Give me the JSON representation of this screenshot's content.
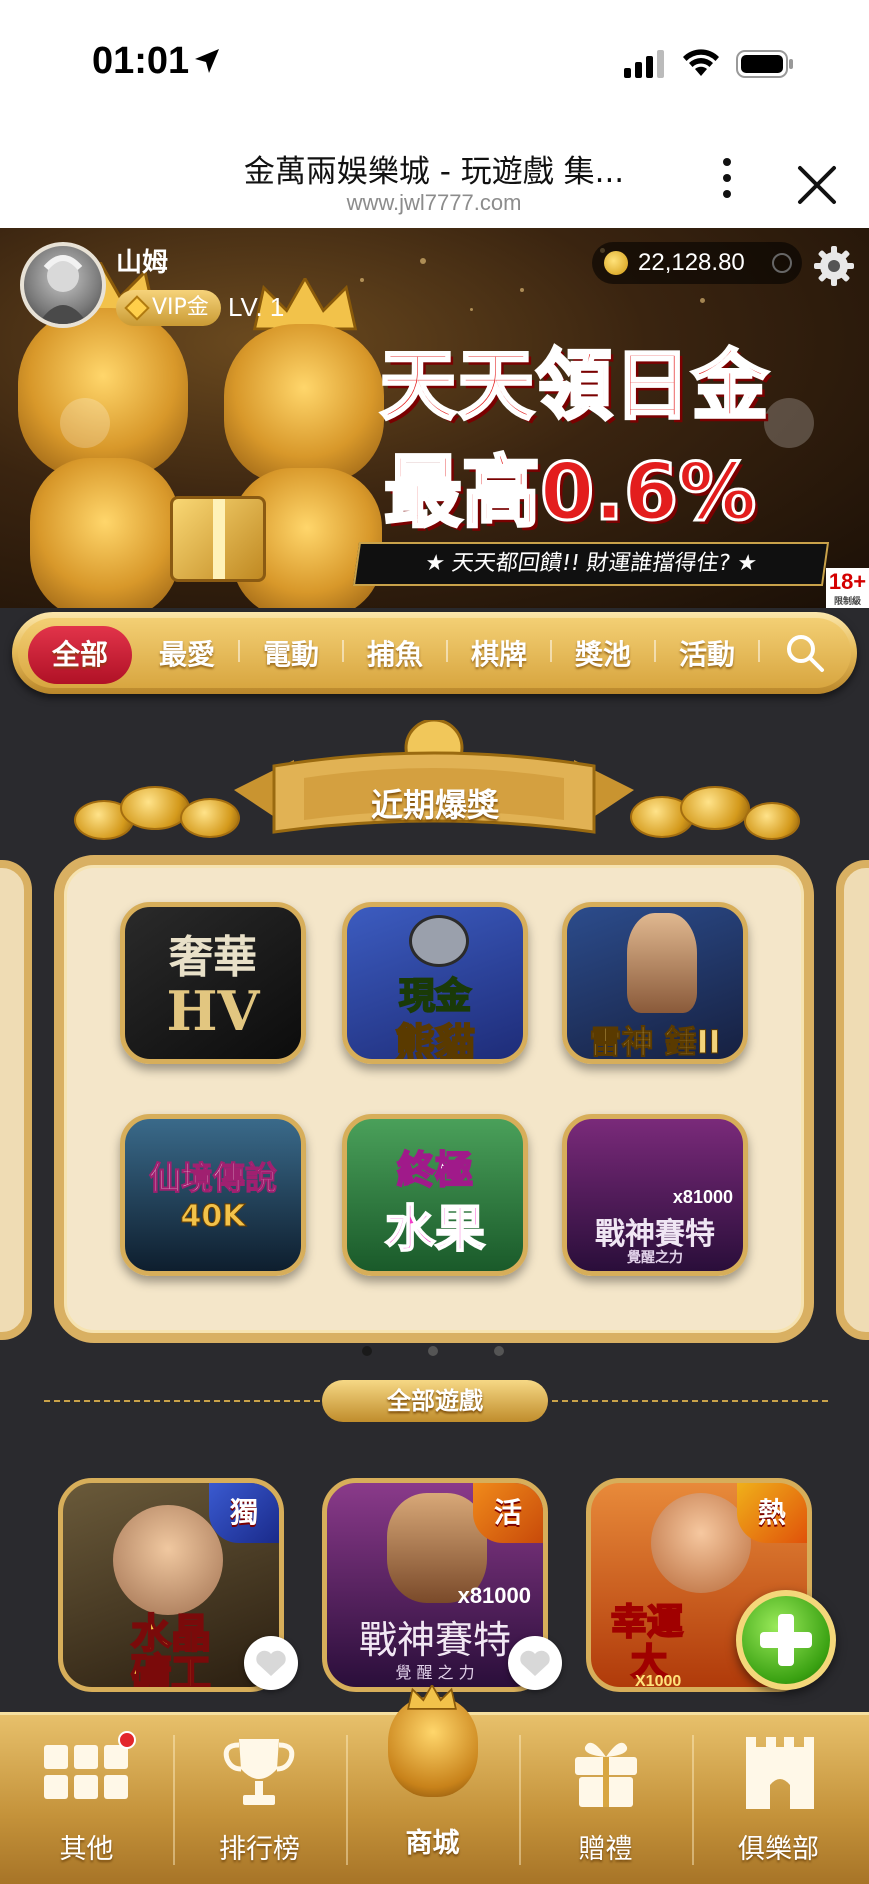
{
  "status_bar": {
    "time": "01:01"
  },
  "browser": {
    "title": "金萬兩娛樂城 - 玩遊戲 集...",
    "url": "www.jwl7777.com"
  },
  "user": {
    "name": "山姆",
    "vip": "VIP金",
    "level": "LV. 1",
    "balance": "22,128.80"
  },
  "banner": {
    "headline": "天天領日金",
    "headline2": "最高0.6%",
    "subtitle": "★ 天天都回饋!! 財運誰擋得住? ★",
    "age_badge": "18+",
    "age_badge_sub": "限制級"
  },
  "tabs": [
    "全部",
    "最愛",
    "電動",
    "捕魚",
    "棋牌",
    "獎池",
    "活動"
  ],
  "recent": {
    "title": "近期爆獎",
    "games": [
      {
        "line1": "奢華",
        "line2": "HV"
      },
      {
        "line1": "現金",
        "line2": "熊貓"
      },
      {
        "line1": "雷神",
        "line2": "錘II"
      },
      {
        "line1": "仙境傳說",
        "line2": "40K"
      },
      {
        "line1": "終極",
        "line2": "水果"
      },
      {
        "line1": "戰神賽特",
        "line2": "覺醒之力",
        "badge": "x81000"
      }
    ]
  },
  "all_games": {
    "label": "全部遊戲",
    "games": [
      {
        "line1": "水晶",
        "line2": "礦工",
        "tag": "獨"
      },
      {
        "line1": "戰神賽特",
        "line2": "覺 醒 之 力",
        "tag": "活",
        "badge": "x81000"
      },
      {
        "line1": "幸運",
        "line2": "大",
        "tag": "熱",
        "badge": "X1000"
      }
    ]
  },
  "bottom_nav": [
    {
      "label": "其他",
      "icon": "grid-icon"
    },
    {
      "label": "排行榜",
      "icon": "trophy-icon"
    },
    {
      "label": "商城",
      "icon": "lion-mascot-icon"
    },
    {
      "label": "贈禮",
      "icon": "gift-icon"
    },
    {
      "label": "俱樂部",
      "icon": "castle-icon"
    }
  ],
  "colors": {
    "active_tab": "#c81f35",
    "gold": "#d8a640",
    "panel": "#f4e6c9",
    "headline_red": "#e31d1d"
  }
}
